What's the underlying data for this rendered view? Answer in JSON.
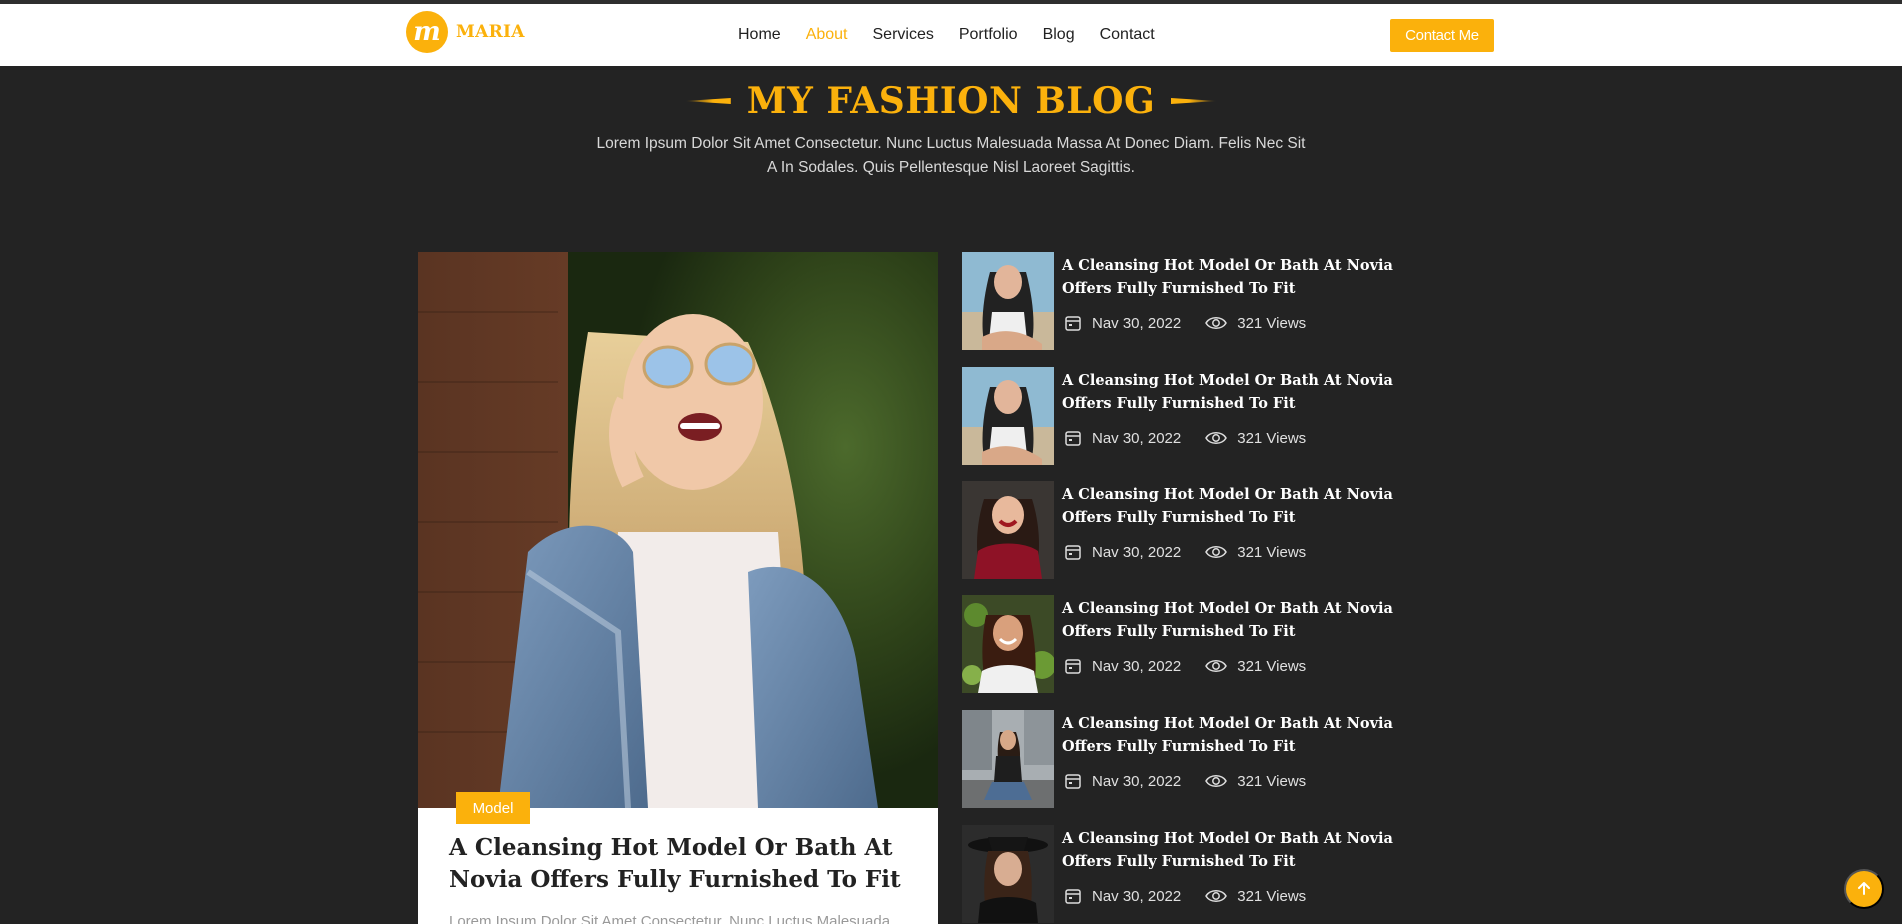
{
  "brand": {
    "logo_letter": "m",
    "name": "MARIA"
  },
  "nav": {
    "items": [
      {
        "label": "Home"
      },
      {
        "label": "About"
      },
      {
        "label": "Services"
      },
      {
        "label": "Portfolio"
      },
      {
        "label": "Blog"
      },
      {
        "label": "Contact"
      }
    ],
    "active": "About",
    "cta_label": "Contact Me"
  },
  "section": {
    "title": "MY FASHION BLOG",
    "subtitle": "Lorem Ipsum Dolor Sit Amet Consectetur. Nunc Luctus Malesuada Massa At Donec Diam. Felis Nec Sit A In Sodales. Quis Pellentesque Nisl Laoreet Sagittis."
  },
  "featured": {
    "tag": "Model",
    "title": "A Cleansing Hot Model Or Bath At Novia Offers Fully Furnished To Fit",
    "excerpt": "Lorem Ipsum Dolor Sit Amet Consectetur. Nunc Luctus Malesuada"
  },
  "posts": [
    {
      "title": "A Cleansing Hot Model Or Bath At Novia Offers Fully Furnished To Fit",
      "date": "Nav 30, 2022",
      "views": "321 Views"
    },
    {
      "title": "A Cleansing Hot Model Or Bath At Novia Offers Fully Furnished To Fit",
      "date": "Nav 30, 2022",
      "views": "321 Views"
    },
    {
      "title": "A Cleansing Hot Model Or Bath At Novia Offers Fully Furnished To Fit",
      "date": "Nav 30, 2022",
      "views": "321 Views"
    },
    {
      "title": "A Cleansing Hot Model Or Bath At Novia Offers Fully Furnished To Fit",
      "date": "Nav 30, 2022",
      "views": "321 Views"
    },
    {
      "title": "A Cleansing Hot Model Or Bath At Novia Offers Fully Furnished To Fit",
      "date": "Nav 30, 2022",
      "views": "321 Views"
    },
    {
      "title": "A Cleansing Hot Model Or Bath At Novia Offers Fully Furnished To Fit",
      "date": "Nav 30, 2022",
      "views": "321 Views"
    }
  ],
  "icons": {
    "date": "calendar-icon",
    "views": "eye-icon",
    "scroll_top": "arrow-up-icon"
  },
  "colors": {
    "accent": "#fbb10c",
    "background": "#232323",
    "nav_bg": "#ffffff"
  }
}
